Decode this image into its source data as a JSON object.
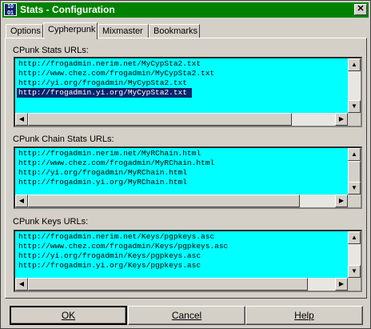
{
  "window": {
    "title": "Stats - Configuration",
    "icon": "app-icon",
    "close_symbol": "✕"
  },
  "tabs": [
    {
      "label": "Options"
    },
    {
      "label": "Cypherpunk"
    },
    {
      "label": "Mixmaster"
    },
    {
      "label": "Bookmarks"
    }
  ],
  "sections": {
    "stats": {
      "label": "CPunk Stats URLs:",
      "items": [
        "http://frogadmin.nerim.net/MyCypSta2.txt",
        "http://www.chez.com/frogadmin/MyCypSta2.txt",
        "http://yi.org/frogadmin/MyCypSta2.txt",
        "http://frogadmin.yi.org/MyCypSta2.txt"
      ],
      "selected_index": 3
    },
    "chain": {
      "label": "CPunk Chain Stats URLs:",
      "items": [
        "http://frogadmin.nerim.net/MyRChain.html",
        "http://www.chez.com/frogadmin/MyRChain.html",
        "http://yi.org/frogadmin/MyRChain.html",
        "http://frogadmin.yi.org/MyRChain.html"
      ]
    },
    "keys": {
      "label": "CPunk Keys URLs:",
      "items": [
        "http://frogadmin.nerim.net/Keys/pgpkeys.asc",
        "http://www.chez.com/frogadmin/Keys/pgpkeys.asc",
        "http://yi.org/frogadmin/Keys/pgpkeys.asc",
        "http://frogadmin.yi.org/Keys/pgpkeys.asc"
      ]
    }
  },
  "buttons": {
    "ok": "OK",
    "cancel": "Cancel",
    "help": "Help"
  },
  "colors": {
    "titlebar": "#008200",
    "list_bg": "#00ffff",
    "selection": "#0a246a"
  }
}
